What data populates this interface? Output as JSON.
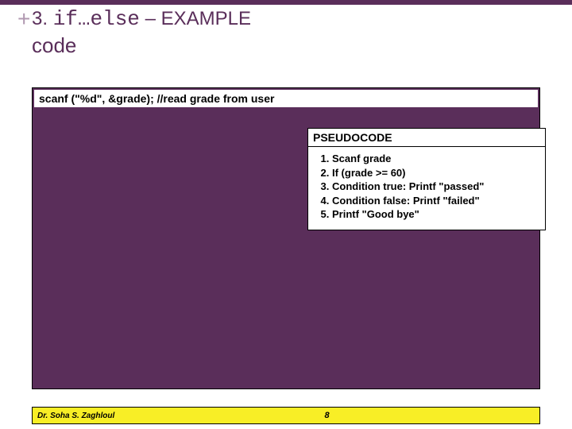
{
  "title": {
    "plus": "+",
    "number": "3. ",
    "codeword": "if…else",
    "rest": " – EXAMPLE",
    "subtitle": "code"
  },
  "code_line": "scanf (\"%d\", &grade); //read grade from user",
  "pseudo": {
    "header": "PSEUDOCODE",
    "items": [
      "Scanf grade",
      "If (grade >= 60)",
      "Condition true: Printf \"passed\"",
      "Condition false: Printf \"failed\"",
      "Printf \"Good bye\""
    ]
  },
  "footer": {
    "author": "Dr. Soha S. Zaghloul",
    "page": "8"
  }
}
